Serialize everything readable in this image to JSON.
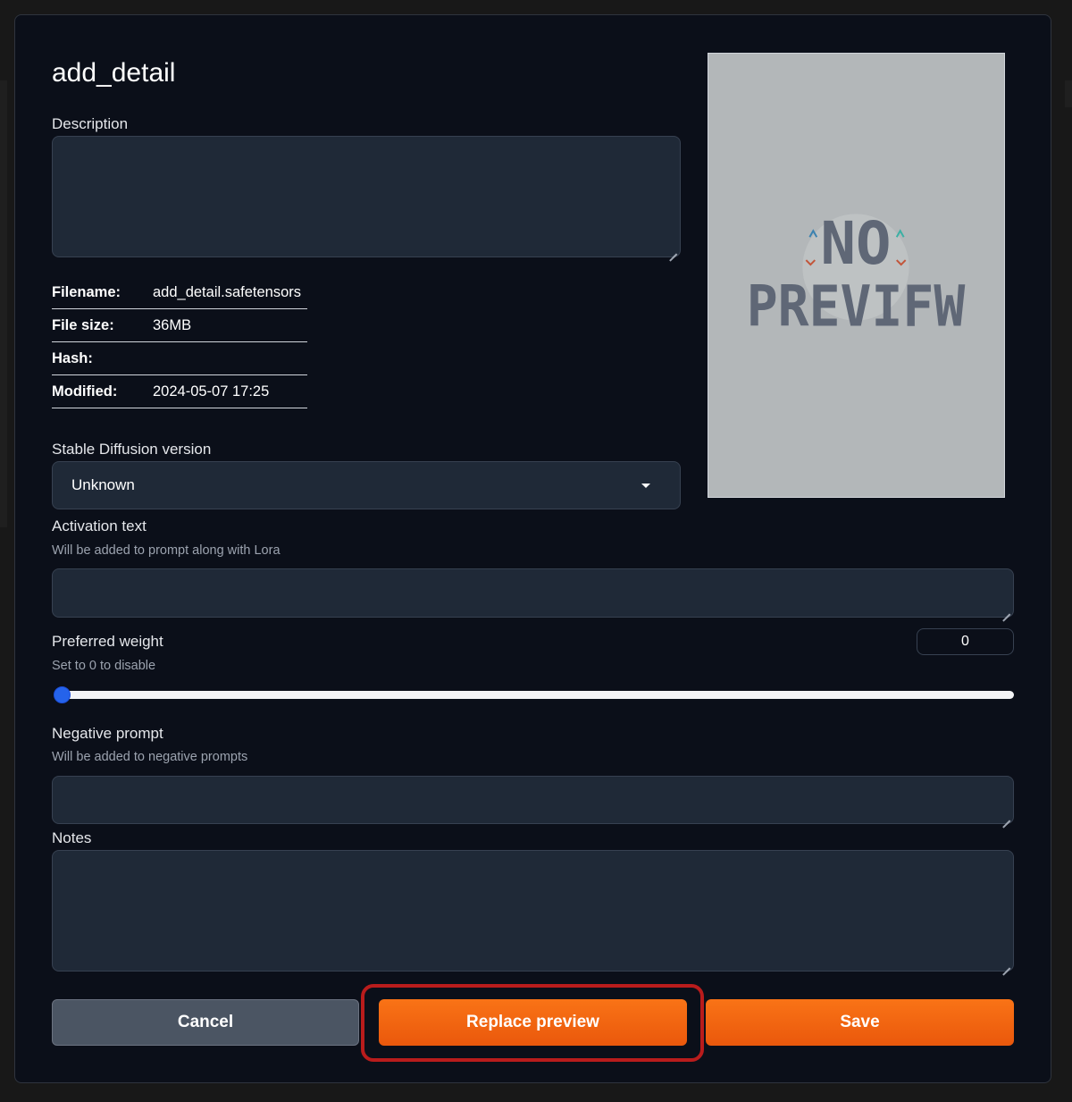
{
  "dialog": {
    "title": "add_detail",
    "description_label": "Description",
    "description_value": "",
    "info": [
      {
        "key": "Filename:",
        "value": "add_detail.safetensors"
      },
      {
        "key": "File size:",
        "value": "36MB"
      },
      {
        "key": "Hash:",
        "value": ""
      },
      {
        "key": "Modified:",
        "value": "2024-05-07 17:25"
      }
    ],
    "sd_version_label": "Stable Diffusion version",
    "sd_version_value": "Unknown",
    "preview_text_line1": "NO",
    "preview_text_line2": "PREVIFW",
    "activation_label": "Activation text",
    "activation_hint": "Will be added to prompt along with Lora",
    "activation_value": "",
    "weight_label": "Preferred weight",
    "weight_hint": "Set to 0 to disable",
    "weight_value": "0",
    "weight_slider_fraction": 0,
    "negative_label": "Negative prompt",
    "negative_hint": "Will be added to negative prompts",
    "negative_value": "",
    "notes_label": "Notes",
    "notes_value": ""
  },
  "buttons": {
    "cancel": "Cancel",
    "replace_preview": "Replace preview",
    "save": "Save"
  },
  "colors": {
    "accent": "#f97316",
    "highlight": "#b91c1c",
    "slider_thumb": "#2563eb"
  }
}
